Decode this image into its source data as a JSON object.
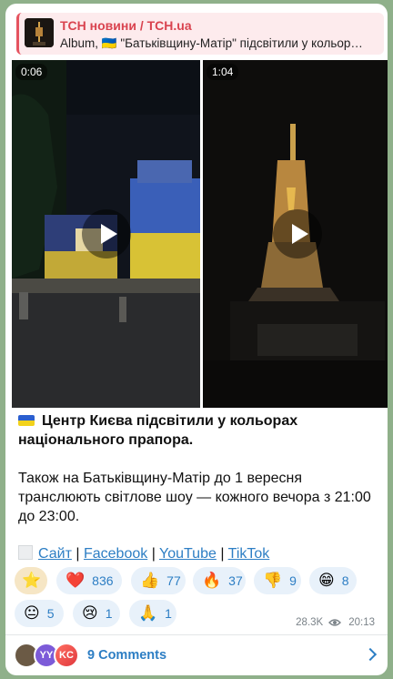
{
  "reply": {
    "sender": "ТСН новини / TCH.ua",
    "text": "Album, 🇺🇦 \"Батьківщину-Матір\" підсвітили у кольор…"
  },
  "media": [
    {
      "duration": "0:06",
      "icon": "play-icon"
    },
    {
      "duration": "1:04",
      "icon": "play-icon"
    }
  ],
  "post": {
    "headline": "Центр Києва підсвітили у кольорах національного прапора.",
    "body": "Також на Батьківщину-Матір до 1 вересня транслюють світлове шоу — кожного вечора з 21:00 до 23:00.",
    "links": [
      "Сайт",
      "Facebook",
      "YouTube",
      "TikTok"
    ],
    "link_separator": "|"
  },
  "reactions": [
    {
      "emoji": "⭐",
      "count": ""
    },
    {
      "emoji": "❤️",
      "count": "836"
    },
    {
      "emoji": "👍",
      "count": "77"
    },
    {
      "emoji": "🔥",
      "count": "37"
    },
    {
      "emoji": "👎",
      "count": "9"
    },
    {
      "emoji": "😁",
      "count": "8"
    },
    {
      "emoji": "😐",
      "count": "5"
    },
    {
      "emoji": "😢",
      "count": "1"
    },
    {
      "emoji": "🙏",
      "count": "1"
    }
  ],
  "meta": {
    "views": "28.3K",
    "time": "20:13"
  },
  "comments": {
    "label": "9 Comments",
    "avatars": [
      "",
      "YY",
      "KC"
    ]
  },
  "colors": {
    "accent": "#2d7ec4",
    "reply_accent": "#d9434f",
    "background": "#8fb08a",
    "flag_blue": "#2b5fcf",
    "flag_yellow": "#f2d21c"
  }
}
